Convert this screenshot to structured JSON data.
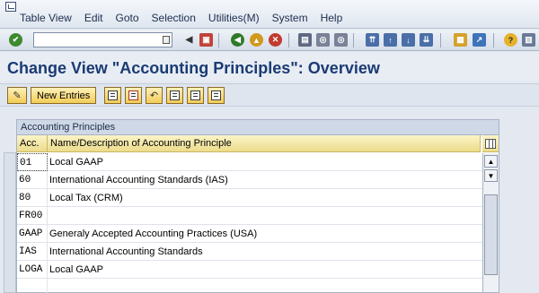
{
  "menu": {
    "items": [
      "Table View",
      "Edit",
      "Goto",
      "Selection",
      "Utilities(M)",
      "System",
      "Help"
    ]
  },
  "toolbar": {
    "command_value": "",
    "icons": [
      "enter-icon",
      "save-icon",
      "back-icon",
      "exit-icon",
      "cancel-icon",
      "print-icon",
      "find-icon",
      "find-next-icon",
      "first-page-icon",
      "prev-page-icon",
      "next-page-icon",
      "last-page-icon",
      "create-session-icon",
      "shortcut-icon",
      "help-icon",
      "layout-menu-icon"
    ]
  },
  "title": "Change View \"Accounting Principles\": Overview",
  "app_toolbar": {
    "new_entries_label": "New Entries",
    "icons": [
      "display-change-icon",
      "copy-as-icon",
      "delete-icon",
      "undo-change-icon",
      "select-all-icon",
      "select-block-icon",
      "deselect-all-icon"
    ]
  },
  "table": {
    "caption": "Accounting Principles",
    "columns": [
      "Acc.",
      "Name/Description of Accounting Principle"
    ],
    "rows": [
      {
        "acc": "01",
        "name": "Local GAAP"
      },
      {
        "acc": "60",
        "name": "International Accounting Standards (IAS)"
      },
      {
        "acc": "80",
        "name": "Local Tax (CRM)"
      },
      {
        "acc": "FR00",
        "name": ""
      },
      {
        "acc": "GAAP",
        "name": "Generaly Accepted Accounting Practices (USA)"
      },
      {
        "acc": "IAS",
        "name": "International Accounting Standards"
      },
      {
        "acc": "LOGA",
        "name": "Local GAAP"
      }
    ]
  }
}
